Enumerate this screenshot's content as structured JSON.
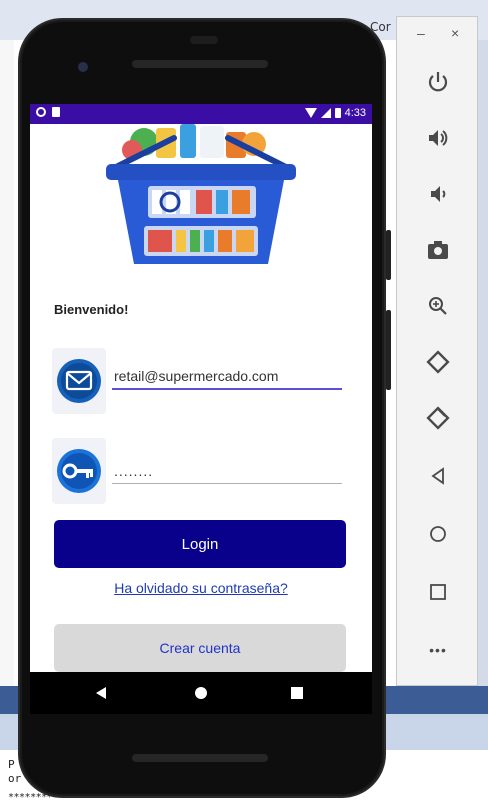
{
  "background_window": {
    "tab_fragment": "Cor",
    "text_line_1": "P",
    "text_line_2": "or",
    "text_line_3": "**********************************************"
  },
  "status_bar": {
    "time": "4:33",
    "color": "#3a0da5"
  },
  "login_screen": {
    "welcome_text": "Bienvenido!",
    "email": {
      "value": "retail@supermercado.com",
      "icon": "envelope-icon"
    },
    "password": {
      "value": "........",
      "icon": "key-icon"
    },
    "login_label": "Login",
    "forgot_label": "Ha olvidado su contraseña?",
    "create_account_label": "Crear cuenta",
    "colors": {
      "primary": "#09008c",
      "link": "#1f3bb3",
      "secondary_button": "#d9d9d9"
    }
  },
  "navigation_bar": {
    "back": "back-icon",
    "home": "home-icon",
    "recents": "recents-icon"
  },
  "emulator_toolbar": {
    "minimize": "–",
    "close": "×",
    "more": "•••",
    "buttons": [
      "power-icon",
      "volume-up-icon",
      "volume-down-icon",
      "camera-icon",
      "zoom-icon",
      "rotate-left-icon",
      "rotate-right-icon",
      "back-icon",
      "home-icon",
      "overview-icon",
      "more-icon"
    ]
  }
}
